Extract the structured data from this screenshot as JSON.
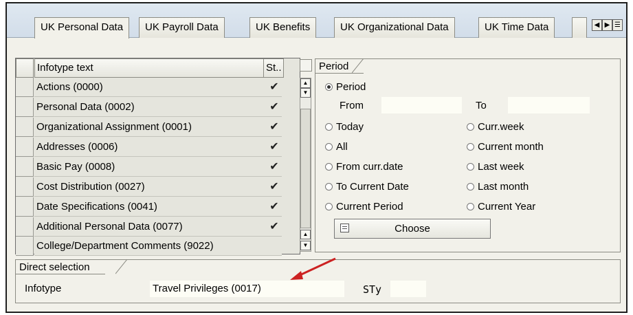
{
  "tabs": [
    {
      "label": "UK Personal Data",
      "active": true
    },
    {
      "label": "UK Payroll Data",
      "active": false
    },
    {
      "label": "UK Benefits",
      "active": false
    },
    {
      "label": "UK Organizational Data",
      "active": false
    },
    {
      "label": "UK Time Data",
      "active": false
    }
  ],
  "infotypes": {
    "header_text": "Infotype text",
    "header_status": "St..",
    "rows": [
      {
        "text": "Actions (0000)",
        "status": "✔"
      },
      {
        "text": "Personal Data (0002)",
        "status": "✔"
      },
      {
        "text": "Organizational Assignment (0001)",
        "status": "✔"
      },
      {
        "text": "Addresses (0006)",
        "status": "✔"
      },
      {
        "text": "Basic Pay (0008)",
        "status": "✔"
      },
      {
        "text": "Cost Distribution (0027)",
        "status": "✔"
      },
      {
        "text": "Date Specifications (0041)",
        "status": "✔"
      },
      {
        "text": "Additional Personal Data (0077)",
        "status": "✔"
      },
      {
        "text": "College/Department Comments (9022)",
        "status": ""
      }
    ]
  },
  "period": {
    "title": "Period",
    "period_option": "Period",
    "from_label": "From",
    "from_value": "",
    "to_label": "To",
    "to_value": "",
    "options_left": [
      "Today",
      "All",
      "From curr.date",
      "To Current Date",
      "Current Period"
    ],
    "options_right": [
      "Curr.week",
      "Current month",
      "Last week",
      "Last month",
      "Current Year"
    ],
    "choose_label": "Choose"
  },
  "direct_selection": {
    "title": "Direct selection",
    "infotype_label": "Infotype",
    "infotype_value": "Travel Privileges (0017)",
    "sty_label": "STy",
    "sty_value": ""
  },
  "colors": {
    "arrow": "#cc2222",
    "panel_bg": "#f2f1ea",
    "field_bg": "#fdfdf5"
  }
}
